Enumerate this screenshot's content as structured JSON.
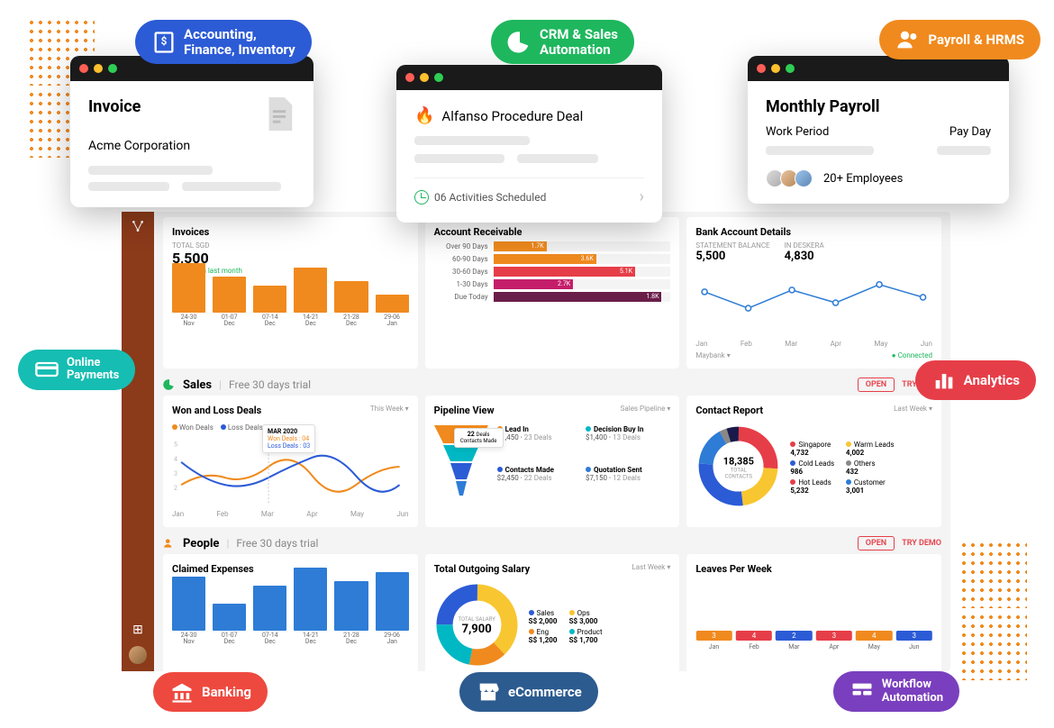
{
  "pills": {
    "accounting": "Accounting,\nFinance, Inventory",
    "crm": "CRM & Sales\nAutomation",
    "payroll": "Payroll & HRMS",
    "payments": "Online\nPayments",
    "analytics": "Analytics",
    "banking": "Banking",
    "ecommerce": "eCommerce",
    "workflow": "Workflow\nAutomation"
  },
  "win_invoice": {
    "title": "Invoice",
    "company": "Acme Corporation"
  },
  "win_deal": {
    "title": "Alfanso Procedure Deal",
    "activities": "06 Activities Scheduled"
  },
  "win_payroll": {
    "title": "Monthly Payroll",
    "workperiod": "Work Period",
    "payday": "Pay Day",
    "employees": "20+ Employees"
  },
  "sections": {
    "sales": {
      "name": "Sales",
      "trial": "Free 30 days trial"
    },
    "people": {
      "name": "People",
      "trial": "Free 30 days trial"
    },
    "open": "OPEN",
    "try": "TRY DEMO"
  },
  "invoices_card": {
    "title": "Invoices",
    "subtitle_label": "TOTAL SGD",
    "total": "5,500",
    "trend": "↑11% from last month",
    "bars": [
      {
        "v": 55,
        "label": "24-30\nNov"
      },
      {
        "v": 40,
        "label": "01-07\nDec"
      },
      {
        "v": 30,
        "label": "07-14\nDec"
      },
      {
        "v": 50,
        "label": "14-21\nDec"
      },
      {
        "v": 35,
        "label": "21-28\nDec"
      },
      {
        "v": 20,
        "label": "29-06\nJan"
      }
    ]
  },
  "ar_card": {
    "title": "Account Receivable",
    "rows": [
      {
        "label": "Over 90 Days",
        "pct": 30,
        "val": "1.7K",
        "color": "#f08a1e"
      },
      {
        "label": "60-90 Days",
        "pct": 58,
        "val": "3.6K",
        "color": "#f08a1e"
      },
      {
        "label": "30-60 Days",
        "pct": 80,
        "val": "5.1K",
        "color": "#e63e48"
      },
      {
        "label": "1-30 Days",
        "pct": 45,
        "val": "2.7K",
        "color": "#c41e6a"
      },
      {
        "label": "Due Today",
        "pct": 95,
        "val": "1.8K",
        "color": "#6a1e4a"
      }
    ]
  },
  "bank_card": {
    "title": "Bank Account Details",
    "stmt_label": "STATEMENT BALANCE",
    "stmt": "5,500",
    "desk_label": "IN DESKERA",
    "desk": "4,830",
    "months": [
      "Jan",
      "Feb",
      "Mar",
      "Apr",
      "May",
      "Jun"
    ],
    "bank_name": "Maybank",
    "status": "Connected"
  },
  "wl_card": {
    "title": "Won and Loss Deals",
    "period": "This Week",
    "won": "Won Deals",
    "loss": "Loss Deals",
    "tooltip": {
      "period": "MAR 2020",
      "won": "Won Deals : 04",
      "loss": "Loss Deals : 03"
    },
    "months": [
      "Jan",
      "Feb",
      "Mar",
      "Apr",
      "May",
      "Jun"
    ]
  },
  "pipeline": {
    "title": "Pipeline View",
    "selector": "Sales Pipeline",
    "funnel_badge": {
      "n": "22",
      "t": "Deals\nContacts Made"
    },
    "items": [
      {
        "name": "Lead In",
        "amt": "$1,450",
        "deals": "23 Deals",
        "color": "#f08a1e"
      },
      {
        "name": "Decision Buy In",
        "amt": "$1,400",
        "deals": "13 Deals",
        "color": "#00b8c4"
      },
      {
        "name": "Contacts Made",
        "amt": "$2,450",
        "deals": "22 Deals",
        "color": "#2c5bd6"
      },
      {
        "name": "Quotation Sent",
        "amt": "$7,150",
        "deals": "12 Deals",
        "color": "#2e7cd6"
      }
    ]
  },
  "contact": {
    "title": "Contact Report",
    "period": "Last Week",
    "center_n": "18,385",
    "center_t": "TOTAL CONTACTS",
    "items": [
      {
        "name": "Singapore",
        "val": "4,732",
        "color": "#e63e48"
      },
      {
        "name": "Warm Leads",
        "val": "4,002",
        "color": "#f8c630"
      },
      {
        "name": "Cold Leads",
        "val": "986",
        "color": "#2c5bd6"
      },
      {
        "name": "Others",
        "val": "432",
        "color": "#888"
      },
      {
        "name": "Hot Leads",
        "val": "5,232",
        "color": "#e63e48"
      },
      {
        "name": "Customer",
        "val": "3,001",
        "color": "#2e7cd6"
      }
    ]
  },
  "expenses": {
    "title": "Claimed Expenses",
    "bars": [
      {
        "v": 60,
        "label": "24-30\nNov"
      },
      {
        "v": 30,
        "label": "01-07\nDec"
      },
      {
        "v": 50,
        "label": "07-14\nDec"
      },
      {
        "v": 70,
        "label": "14-21\nDec"
      },
      {
        "v": 55,
        "label": "21-28\nDec"
      },
      {
        "v": 65,
        "label": "29-06\nJan"
      }
    ]
  },
  "salary": {
    "title": "Total Outgoing Salary",
    "period": "Last Week",
    "center_t": "TOTAL SALARY",
    "center_n": "7,900",
    "items": [
      {
        "name": "Sales",
        "val": "S$ 2,000",
        "color": "#2c5bd6"
      },
      {
        "name": "Ops",
        "val": "S$ 3,000",
        "color": "#f8c630"
      },
      {
        "name": "Eng",
        "val": "S$ 1,200",
        "color": "#f08a1e"
      },
      {
        "name": "Product",
        "val": "S$ 1,700",
        "color": "#00b8c4"
      }
    ]
  },
  "leaves": {
    "title": "Leaves Per Week",
    "items": [
      {
        "v": 3,
        "label": "Jan",
        "color": "#f08a1e"
      },
      {
        "v": 4,
        "label": "Feb",
        "color": "#e63e48"
      },
      {
        "v": 2,
        "label": "Mar",
        "color": "#2c5bd6"
      },
      {
        "v": 3,
        "label": "Apr",
        "color": "#e63e48"
      },
      {
        "v": 4,
        "label": "May",
        "color": "#f08a1e"
      },
      {
        "v": 3,
        "label": "Jun",
        "color": "#2c5bd6"
      }
    ]
  },
  "chart_data": [
    {
      "type": "bar",
      "title": "Invoices",
      "categories": [
        "24-30 Nov",
        "01-07 Dec",
        "07-14 Dec",
        "14-21 Dec",
        "21-28 Dec",
        "29-06 Jan"
      ],
      "values": [
        55,
        40,
        30,
        50,
        35,
        20
      ],
      "ylim": [
        0,
        100
      ]
    },
    {
      "type": "bar",
      "title": "Account Receivable",
      "categories": [
        "Over 90 Days",
        "60-90 Days",
        "30-60 Days",
        "1-30 Days",
        "Due Today"
      ],
      "values": [
        1.7,
        3.6,
        5.1,
        2.7,
        1.8
      ],
      "ylabel": "K"
    },
    {
      "type": "line",
      "title": "Bank Account Details",
      "x": [
        "Jan",
        "Feb",
        "Mar",
        "Apr",
        "May",
        "Jun"
      ],
      "series": [
        {
          "name": "Balance",
          "values": [
            5.0,
            3.8,
            5.3,
            4.2,
            5.6,
            4.9
          ]
        }
      ]
    },
    {
      "type": "line",
      "title": "Won and Loss Deals",
      "x": [
        "Jan",
        "Feb",
        "Mar",
        "Apr",
        "May",
        "Jun"
      ],
      "series": [
        {
          "name": "Won Deals",
          "values": [
            2,
            3,
            4,
            3,
            2,
            4
          ]
        },
        {
          "name": "Loss Deals",
          "values": [
            4,
            2,
            3,
            5,
            3,
            2
          ]
        }
      ]
    },
    {
      "type": "pie",
      "title": "Contact Report",
      "categories": [
        "Singapore",
        "Warm Leads",
        "Cold Leads",
        "Others",
        "Hot Leads",
        "Customer"
      ],
      "values": [
        4732,
        4002,
        986,
        432,
        5232,
        3001
      ]
    },
    {
      "type": "bar",
      "title": "Claimed Expenses",
      "categories": [
        "24-30 Nov",
        "01-07 Dec",
        "07-14 Dec",
        "14-21 Dec",
        "21-28 Dec",
        "29-06 Jan"
      ],
      "values": [
        60,
        30,
        50,
        70,
        55,
        65
      ]
    },
    {
      "type": "pie",
      "title": "Total Outgoing Salary",
      "categories": [
        "Sales",
        "Ops",
        "Eng",
        "Product"
      ],
      "values": [
        2000,
        3000,
        1200,
        1700
      ]
    },
    {
      "type": "bar",
      "title": "Leaves Per Week",
      "categories": [
        "Jan",
        "Feb",
        "Mar",
        "Apr",
        "May",
        "Jun"
      ],
      "values": [
        3,
        4,
        2,
        3,
        4,
        3
      ]
    }
  ]
}
